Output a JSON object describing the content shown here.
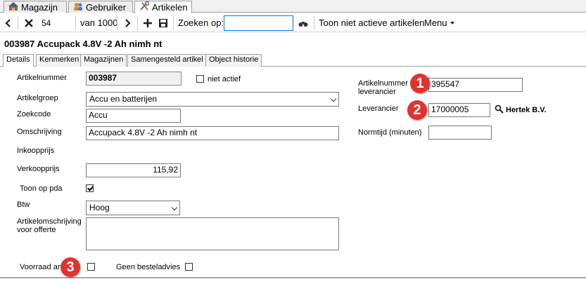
{
  "top_tabs": [
    {
      "label": "Magazijn",
      "icon": "warehouse-icon"
    },
    {
      "label": "Gebruiker",
      "icon": "users-icon"
    },
    {
      "label": "Artikelen",
      "icon": "tools-icon"
    }
  ],
  "toolbar": {
    "record_value": "54",
    "of_label": "van 1000",
    "search_label": "Zoeken op:",
    "search_value": "",
    "inactive_label": "Toon niet actieve artikelen",
    "menu_label": "Menu"
  },
  "title": "003987 Accupack 4.8V -2 Ah nimh nt",
  "sub_tabs": [
    "Details",
    "Kenmerken",
    "Magazijnen",
    "Samengesteld artikel",
    "Object historie"
  ],
  "form": {
    "artikelnummer_label": "Artikelnummer",
    "artikelnummer_value": "003987",
    "niet_actief_label": "niet actief",
    "artikelgroep_label": "Artikelgroep",
    "artikelgroep_value": "Accu en batterijen",
    "zoekcode_label": "Zoekcode",
    "zoekcode_value": "Accu",
    "omschrijving_label": "Omschrijving",
    "omschrijving_value": "Accupack 4.8V -2 Ah nimh nt",
    "inkoopprijs_label": "Inkoopprijs",
    "verkoopprijs_label": "Verkoopprijs",
    "verkoopprijs_value": "115,92",
    "toon_op_pda_label": "Toon op pda",
    "btw_label": "Btw",
    "btw_value": "Hoog",
    "artikelomschrijving_label_1": "Artikelomschrijving",
    "artikelomschrijving_label_2": "voor offerte",
    "artikelomschrijving_value": "",
    "voorraad_label": "Voorraad art",
    "geen_besteladvies_label": "Geen besteladvies",
    "art_lev_label_1": "Artikelnummer",
    "art_lev_label_2": "leverancier",
    "art_lev_value": "395547",
    "leverancier_label": "Leverancier",
    "leverancier_value": "17000005",
    "leverancier_name": "Hertek B.V.",
    "normtijd_label": "Normtijd (minuten)",
    "normtijd_value": ""
  },
  "checkbox_state": {
    "niet_actief": false,
    "toon_op_pda": true,
    "voorraad": false,
    "geen_besteladvies": false
  },
  "badges": [
    "1",
    "2",
    "3"
  ],
  "colors": {
    "badge": "#e0332e"
  }
}
